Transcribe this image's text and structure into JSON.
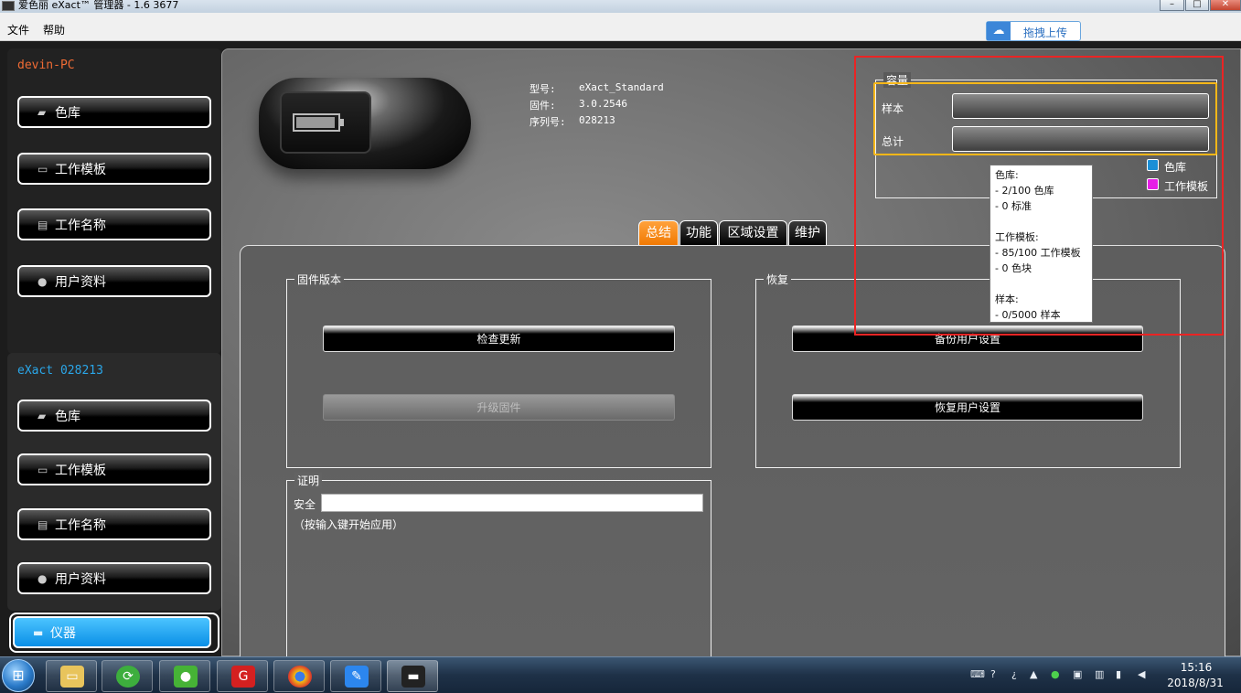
{
  "window": {
    "title": "爱色丽 eXact™ 管理器 - 1.6  3677"
  },
  "menu": {
    "items": [
      "文件",
      "帮助"
    ]
  },
  "upload_button": {
    "label": "拖拽上传"
  },
  "sidebar": {
    "pc_name": "devin-PC",
    "pc_items": [
      {
        "label": "色库",
        "icon": "palette-icon"
      },
      {
        "label": "工作模板",
        "icon": "folder-icon"
      },
      {
        "label": "工作名称",
        "icon": "database-icon"
      },
      {
        "label": "用户资料",
        "icon": "user-icon"
      }
    ],
    "device_name": "eXact  028213",
    "device_items": [
      {
        "label": "色库",
        "icon": "palette-icon"
      },
      {
        "label": "工作模板",
        "icon": "folder-icon"
      },
      {
        "label": "工作名称",
        "icon": "database-icon"
      },
      {
        "label": "用户资料",
        "icon": "user-icon"
      },
      {
        "label": "仪器",
        "icon": "instrument-icon",
        "selected": true
      }
    ]
  },
  "device_info": {
    "model_label": "型号:",
    "model_value": "eXact_Standard",
    "firmware_label": "固件:",
    "firmware_value": "3.0.2546",
    "serial_label": "序列号:",
    "serial_value": "028213"
  },
  "capacity": {
    "title": "容量",
    "rows": [
      "样本",
      "总计"
    ],
    "legend": [
      {
        "label": "色库",
        "color": "#1a8fd6"
      },
      {
        "label": "工作模板",
        "color": "#e61ee6"
      }
    ]
  },
  "tooltip": {
    "lines": [
      "色库:",
      "- 2/100 色库",
      "- 0 标准",
      "",
      "工作模板:",
      "- 85/100 工作模板",
      "- 0 色块",
      "",
      "样本:",
      "- 0/5000 样本"
    ]
  },
  "tabs": [
    {
      "label": "总结",
      "active": true
    },
    {
      "label": "功能"
    },
    {
      "label": "区域设置"
    },
    {
      "label": "维护"
    }
  ],
  "firmware_section": {
    "title": "固件版本",
    "check_update": "检查更新",
    "upgrade": "升级固件"
  },
  "restore_section": {
    "title": "恢复",
    "backup": "备份用户设置",
    "restore": "恢复用户设置"
  },
  "certificate_section": {
    "title": "证明",
    "security_label": "安全",
    "hint": "（按输入键开始应用）"
  },
  "taskbar": {
    "time": "15:16",
    "date": "2018/8/31"
  },
  "colors": {
    "accent_orange": "#f07800",
    "accent_blue": "#0a8fe6",
    "pc_name": "#f06b34",
    "device_name": "#2aa6e8",
    "highlight_red": "#ea2424",
    "highlight_yellow": "#f7b718"
  }
}
